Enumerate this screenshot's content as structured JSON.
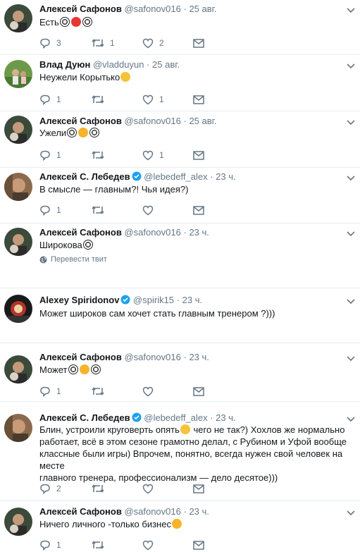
{
  "tweets": [
    {
      "name": "Алексей Сафонов",
      "handle": "@safonov016",
      "sep": "·",
      "time": "25 авг.",
      "text": "Есть",
      "emojis": [
        "ball",
        "angry",
        "ball"
      ],
      "replies": "3",
      "retweets": "1",
      "likes": "2"
    },
    {
      "name": "Влад Дуюн",
      "handle": "@vladduyun",
      "sep": "·",
      "time": "25 авг.",
      "text": "Неужели Корытько",
      "emojis": [
        "laugh"
      ],
      "replies": "1",
      "retweets": "",
      "likes": "1"
    },
    {
      "name": "Алексей Сафонов",
      "handle": "@safonov016",
      "sep": "·",
      "time": "25 авг.",
      "text": "Ужели",
      "emojis": [
        "ball",
        "smile",
        "ball"
      ],
      "replies": "1",
      "retweets": "",
      "likes": "1"
    },
    {
      "name": "Алексей С. Лебедев",
      "handle": "@lebedeff_alex",
      "sep": "·",
      "time": "23 ч.",
      "verified": true,
      "text": "В смысле — главным?! Чья идея?)",
      "emojis": [],
      "replies": "1",
      "retweets": "",
      "likes": ""
    },
    {
      "name": "Алексей Сафонов",
      "handle": "@safonov016",
      "sep": "·",
      "time": "23 ч.",
      "text": "Широкова",
      "emojis": [
        "ball"
      ],
      "translate": "Перевести твит"
    },
    {
      "name": "Alexey Spiridonov",
      "handle": "@spirik15",
      "sep": "·",
      "time": "23 ч.",
      "verified": true,
      "text": "Может широков сам хочет стать главным тренером ?)))",
      "emojis": []
    },
    {
      "name": "Алексей Сафонов",
      "handle": "@safonov016",
      "sep": "·",
      "time": "23 ч.",
      "text": "Может",
      "emojis": [
        "ball",
        "smile",
        "ball"
      ],
      "replies": "1",
      "retweets": "",
      "likes": ""
    },
    {
      "name": "Алексей С. Лебедев",
      "handle": "@lebedeff_alex",
      "sep": "·",
      "time": "23 ч.",
      "verified": true,
      "text_parts": [
        "Блин, устроили круговерть опять",
        " чего не так?) Хохлов же нормально",
        "работает, всё в этом сезоне грамотно делал, с Рубином и Уфой вообще",
        "классные были игры) Впрочем, понятно, всегда нужен свой человек на месте",
        "главного тренера, профессионализм — дело десятое)))"
      ],
      "replies": "2",
      "retweets": "",
      "likes": ""
    },
    {
      "name": "Алексей Сафонов",
      "handle": "@safonov016",
      "sep": "·",
      "time": "23 ч.",
      "text": "Ничего личного -только бизнес",
      "emojis": [
        "smile"
      ],
      "replies": "1",
      "retweets": "",
      "likes": ""
    }
  ]
}
